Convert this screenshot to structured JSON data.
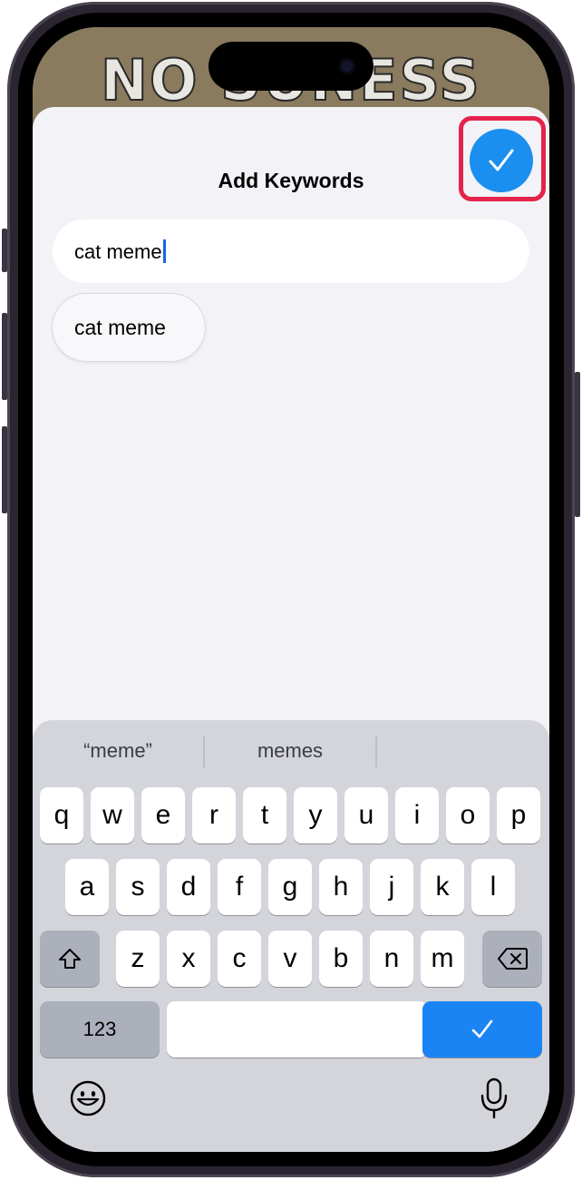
{
  "background": {
    "text": "NO SUNESS"
  },
  "header": {
    "title": "Add Keywords"
  },
  "keyword_field": {
    "value": "cat meme"
  },
  "suggestions": [
    {
      "label": "cat meme"
    }
  ],
  "keyboard": {
    "predictions": [
      "“meme”",
      "memes",
      ""
    ],
    "row1": [
      "q",
      "w",
      "e",
      "r",
      "t",
      "y",
      "u",
      "i",
      "o",
      "p"
    ],
    "row2": [
      "a",
      "s",
      "d",
      "f",
      "g",
      "h",
      "j",
      "k",
      "l"
    ],
    "row3": [
      "z",
      "x",
      "c",
      "v",
      "b",
      "n",
      "m"
    ],
    "numbers_label": "123"
  },
  "colors": {
    "accent": "#1b8ff0",
    "highlight": "#e5234a",
    "keyboard_bg": "#d3d5db"
  }
}
